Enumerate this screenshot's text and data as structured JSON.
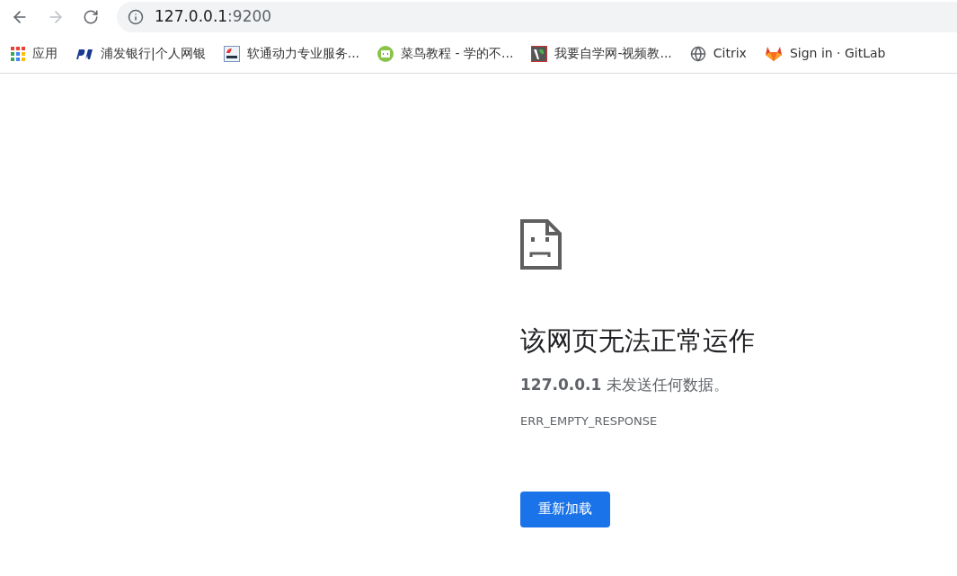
{
  "toolbar": {
    "back": {
      "disabled": false
    },
    "forward": {
      "disabled": true
    },
    "address": {
      "host": "127.0.0.1",
      "rest": ":9200"
    }
  },
  "bookmarks": [
    {
      "kind": "apps",
      "label": "应用"
    },
    {
      "kind": "bank",
      "label": "浦发银行|个人网银"
    },
    {
      "kind": "psa",
      "label": "软通动力专业服务..."
    },
    {
      "kind": "code",
      "label": "菜鸟教程 - 学的不..."
    },
    {
      "kind": "leaf",
      "label": "我要自学网-视频教..."
    },
    {
      "kind": "globe",
      "label": "Citrix"
    },
    {
      "kind": "fox",
      "label": "Sign in · GitLab"
    }
  ],
  "error": {
    "title": "该网页无法正常运作",
    "message": "**127.0.0.1** 未发送任何数据。",
    "code": "ERR_EMPTY_RESPONSE",
    "button": "重新加载"
  }
}
